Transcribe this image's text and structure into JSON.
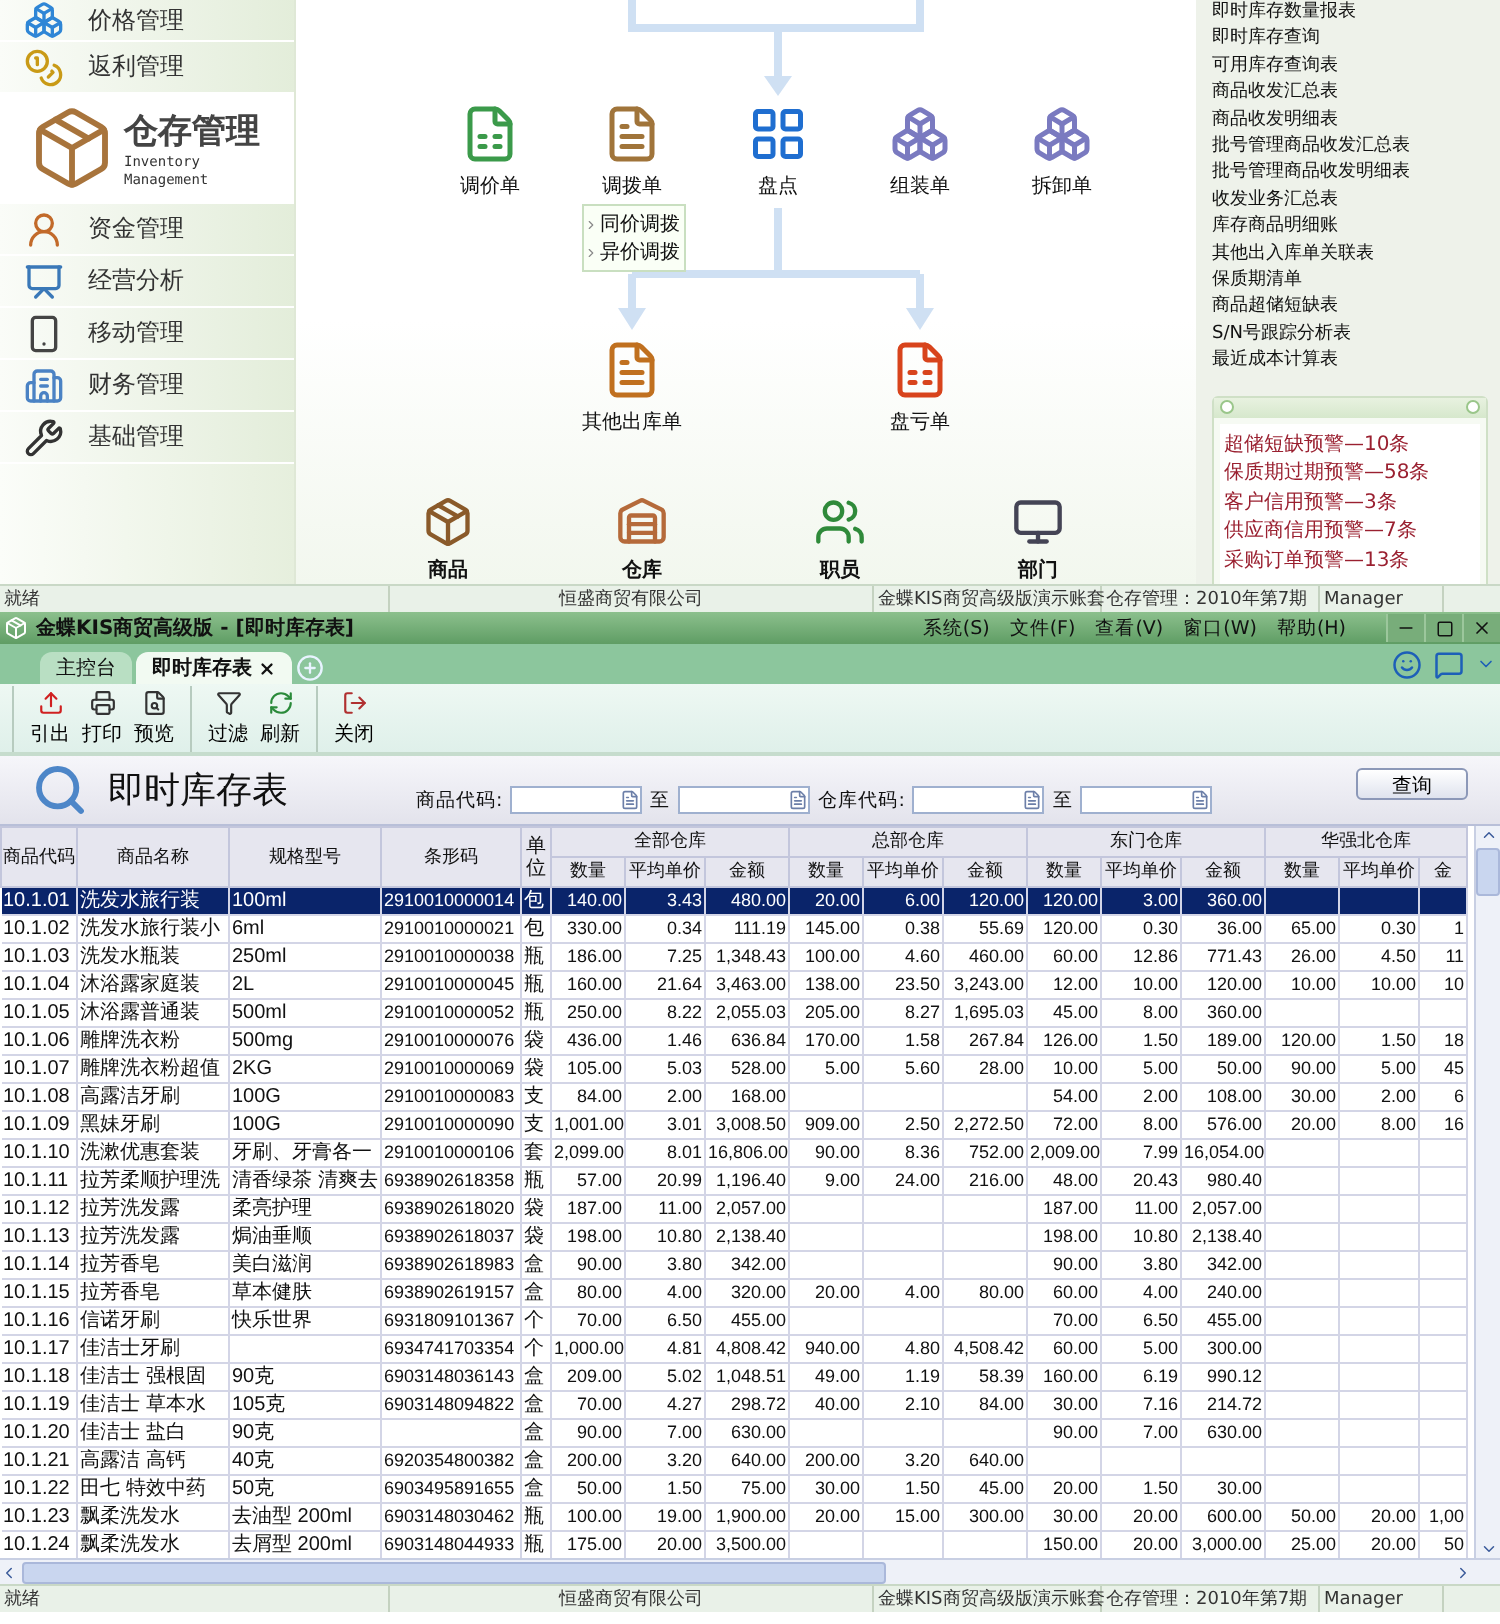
{
  "console": {
    "sidebar": {
      "items": [
        {
          "label": "价格管理",
          "selected": false
        },
        {
          "label": "返利管理",
          "selected": false
        },
        {
          "label": "仓存管理",
          "subtitle": "Inventory Management",
          "selected": true
        },
        {
          "label": "资金管理",
          "selected": false
        },
        {
          "label": "经营分析",
          "selected": false
        },
        {
          "label": "移动管理",
          "selected": false
        },
        {
          "label": "财务管理",
          "selected": false
        },
        {
          "label": "基础管理",
          "selected": false
        }
      ]
    },
    "flow": {
      "nodes": [
        "调价单",
        "调拨单",
        "盘点",
        "组装单",
        "拆卸单",
        "其他出库单",
        "盘亏单"
      ],
      "menu": [
        "同价调拨",
        "异价调拨"
      ],
      "shortcuts": [
        "商品",
        "仓库",
        "职员",
        "部门"
      ]
    },
    "reports": [
      "即时库存数量报表",
      "即时库存查询",
      "可用库存查询表",
      "商品收发汇总表",
      "商品收发明细表",
      "批号管理商品收发汇总表",
      "批号管理商品收发明细表",
      "收发业务汇总表",
      "库存商品明细账",
      "其他出入库单关联表",
      "保质期清单",
      "商品超储短缺表",
      "S/N号跟踪分析表",
      "最近成本计算表"
    ],
    "alerts": [
      "超储短缺预警—10条",
      "保质期过期预警—58条",
      "客户信用预警—3条",
      "供应商信用预警—7条",
      "采购订单预警—13条"
    ],
    "status_bar": [
      "就绪",
      "恒盛商贸有限公司",
      "金蝶KIS商贸高级版演示账套",
      "仓存管理：2010年第7期",
      "Manager"
    ]
  },
  "window": {
    "title": "金蝶KIS商贸高级版 - [即时库存表]",
    "menus": [
      "系统(S)",
      "文件(F)",
      "查看(V)",
      "窗口(W)",
      "帮助(H)"
    ],
    "tabs": [
      {
        "label": "主控台",
        "selected": false,
        "closable": false
      },
      {
        "label": "即时库存表",
        "selected": true,
        "closable": true
      }
    ],
    "toolbar": [
      [
        "引出",
        "打印",
        "预览"
      ],
      [
        "过滤",
        "刷新"
      ],
      [
        "关闭"
      ]
    ],
    "report": {
      "title": "即时库存表",
      "filters": [
        {
          "label": "商品代码:",
          "to": "至"
        },
        {
          "label": "仓库代码:",
          "to": "至"
        }
      ],
      "query_button": "查询"
    },
    "table": {
      "columns": [
        "商品代码",
        "商品名称",
        "规格型号",
        "条形码",
        "单位"
      ],
      "groups": [
        {
          "label": "全部仓库",
          "columns": [
            "数量",
            "平均单价",
            "金额"
          ]
        },
        {
          "label": "总部仓库",
          "columns": [
            "数量",
            "平均单价",
            "金额"
          ]
        },
        {
          "label": "东门仓库",
          "columns": [
            "数量",
            "平均单价",
            "金额"
          ]
        },
        {
          "label": "华强北仓库",
          "columns": [
            "数量",
            "平均单价",
            "金"
          ]
        }
      ],
      "rows": [
        {
          "code": "10.1.01",
          "name": "洗发水旅行装",
          "spec": "100ml",
          "barcode": "2910010000014",
          "unit": "包",
          "selected": true,
          "all": [
            "140.00",
            "3.43",
            "480.00"
          ],
          "hq": [
            "20.00",
            "6.00",
            "120.00"
          ],
          "east": [
            "120.00",
            "3.00",
            "360.00"
          ]
        },
        {
          "code": "10.1.02",
          "name": "洗发水旅行装小",
          "spec": "6ml",
          "barcode": "2910010000021",
          "unit": "包",
          "selected": false,
          "all": [
            "330.00",
            "0.34",
            "111.19"
          ],
          "hq": [
            "145.00",
            "0.38",
            "55.69"
          ],
          "east": [
            "120.00",
            "0.30",
            "36.00"
          ],
          "north": [
            "65.00",
            "0.30",
            "1"
          ]
        },
        {
          "code": "10.1.03",
          "name": "洗发水瓶装",
          "spec": "250ml",
          "barcode": "2910010000038",
          "unit": "瓶",
          "selected": false,
          "all": [
            "186.00",
            "7.25",
            "1,348.43"
          ],
          "hq": [
            "100.00",
            "4.60",
            "460.00"
          ],
          "east": [
            "60.00",
            "12.86",
            "771.43"
          ],
          "north": [
            "26.00",
            "4.50",
            "11"
          ]
        },
        {
          "code": "10.1.04",
          "name": "沐浴露家庭装",
          "spec": "2L",
          "barcode": "2910010000045",
          "unit": "瓶",
          "selected": false,
          "all": [
            "160.00",
            "21.64",
            "3,463.00"
          ],
          "hq": [
            "138.00",
            "23.50",
            "3,243.00"
          ],
          "east": [
            "12.00",
            "10.00",
            "120.00"
          ],
          "north": [
            "10.00",
            "10.00",
            "10"
          ]
        },
        {
          "code": "10.1.05",
          "name": "沐浴露普通装",
          "spec": "500ml",
          "barcode": "2910010000052",
          "unit": "瓶",
          "selected": false,
          "all": [
            "250.00",
            "8.22",
            "2,055.03"
          ],
          "hq": [
            "205.00",
            "8.27",
            "1,695.03"
          ],
          "east": [
            "45.00",
            "8.00",
            "360.00"
          ]
        },
        {
          "code": "10.1.06",
          "name": "雕牌洗衣粉",
          "spec": "500mg",
          "barcode": "2910010000076",
          "unit": "袋",
          "selected": false,
          "all": [
            "436.00",
            "1.46",
            "636.84"
          ],
          "hq": [
            "170.00",
            "1.58",
            "267.84"
          ],
          "east": [
            "126.00",
            "1.50",
            "189.00"
          ],
          "north": [
            "120.00",
            "1.50",
            "18"
          ]
        },
        {
          "code": "10.1.07",
          "name": "雕牌洗衣粉超值",
          "spec": "2KG",
          "barcode": "2910010000069",
          "unit": "袋",
          "selected": false,
          "all": [
            "105.00",
            "5.03",
            "528.00"
          ],
          "hq": [
            "5.00",
            "5.60",
            "28.00"
          ],
          "east": [
            "10.00",
            "5.00",
            "50.00"
          ],
          "north": [
            "90.00",
            "5.00",
            "45"
          ]
        },
        {
          "code": "10.1.08",
          "name": "高露洁牙刷",
          "spec": "100G",
          "barcode": "2910010000083",
          "unit": "支",
          "selected": false,
          "all": [
            "84.00",
            "2.00",
            "168.00"
          ],
          "east": [
            "54.00",
            "2.00",
            "108.00"
          ],
          "north": [
            "30.00",
            "2.00",
            "6"
          ]
        },
        {
          "code": "10.1.09",
          "name": "黑妹牙刷",
          "spec": "100G",
          "barcode": "2910010000090",
          "unit": "支",
          "selected": false,
          "all": [
            "1,001.00",
            "3.01",
            "3,008.50"
          ],
          "hq": [
            "909.00",
            "2.50",
            "2,272.50"
          ],
          "east": [
            "72.00",
            "8.00",
            "576.00"
          ],
          "north": [
            "20.00",
            "8.00",
            "16"
          ]
        },
        {
          "code": "10.1.10",
          "name": "洗漱优惠套装",
          "spec": "牙刷、牙膏各一",
          "barcode": "2910010000106",
          "unit": "套",
          "selected": false,
          "all": [
            "2,099.00",
            "8.01",
            "16,806.00"
          ],
          "hq": [
            "90.00",
            "8.36",
            "752.00"
          ],
          "east": [
            "2,009.00",
            "7.99",
            "16,054.00"
          ]
        },
        {
          "code": "10.1.11",
          "name": "拉芳柔顺护理洗",
          "spec": "清香绿茶 清爽去",
          "barcode": "6938902618358",
          "unit": "瓶",
          "selected": false,
          "all": [
            "57.00",
            "20.99",
            "1,196.40"
          ],
          "hq": [
            "9.00",
            "24.00",
            "216.00"
          ],
          "east": [
            "48.00",
            "20.43",
            "980.40"
          ]
        },
        {
          "code": "10.1.12",
          "name": "拉芳洗发露",
          "spec": "柔亮护理",
          "barcode": "6938902618020",
          "unit": "袋",
          "selected": false,
          "all": [
            "187.00",
            "11.00",
            "2,057.00"
          ],
          "east": [
            "187.00",
            "11.00",
            "2,057.00"
          ]
        },
        {
          "code": "10.1.13",
          "name": "拉芳洗发露",
          "spec": "焗油垂顺",
          "barcode": "6938902618037",
          "unit": "袋",
          "selected": false,
          "all": [
            "198.00",
            "10.80",
            "2,138.40"
          ],
          "east": [
            "198.00",
            "10.80",
            "2,138.40"
          ]
        },
        {
          "code": "10.1.14",
          "name": "拉芳香皂",
          "spec": "美白滋润",
          "barcode": "6938902618983",
          "unit": "盒",
          "selected": false,
          "all": [
            "90.00",
            "3.80",
            "342.00"
          ],
          "east": [
            "90.00",
            "3.80",
            "342.00"
          ]
        },
        {
          "code": "10.1.15",
          "name": "拉芳香皂",
          "spec": "草本健肤",
          "barcode": "6938902619157",
          "unit": "盒",
          "selected": false,
          "all": [
            "80.00",
            "4.00",
            "320.00"
          ],
          "hq": [
            "20.00",
            "4.00",
            "80.00"
          ],
          "east": [
            "60.00",
            "4.00",
            "240.00"
          ]
        },
        {
          "code": "10.1.16",
          "name": "信诺牙刷",
          "spec": "快乐世界",
          "barcode": "6931809101367",
          "unit": "个",
          "selected": false,
          "all": [
            "70.00",
            "6.50",
            "455.00"
          ],
          "east": [
            "70.00",
            "6.50",
            "455.00"
          ]
        },
        {
          "code": "10.1.17",
          "name": "佳洁士牙刷",
          "barcode": "6934741703354",
          "unit": "个",
          "selected": false,
          "all": [
            "1,000.00",
            "4.81",
            "4,808.42"
          ],
          "hq": [
            "940.00",
            "4.80",
            "4,508.42"
          ],
          "east": [
            "60.00",
            "5.00",
            "300.00"
          ]
        },
        {
          "code": "10.1.18",
          "name": "佳洁士 强根固",
          "spec": "90克",
          "barcode": "6903148036143",
          "unit": "盒",
          "selected": false,
          "all": [
            "209.00",
            "5.02",
            "1,048.51"
          ],
          "hq": [
            "49.00",
            "1.19",
            "58.39"
          ],
          "east": [
            "160.00",
            "6.19",
            "990.12"
          ]
        },
        {
          "code": "10.1.19",
          "name": "佳洁士 草本水",
          "spec": "105克",
          "barcode": "6903148094822",
          "unit": "盒",
          "selected": false,
          "all": [
            "70.00",
            "4.27",
            "298.72"
          ],
          "hq": [
            "40.00",
            "2.10",
            "84.00"
          ],
          "east": [
            "30.00",
            "7.16",
            "214.72"
          ]
        },
        {
          "code": "10.1.20",
          "name": "佳洁士 盐白",
          "spec": "90克",
          "unit": "盒",
          "selected": false,
          "all": [
            "90.00",
            "7.00",
            "630.00"
          ],
          "east": [
            "90.00",
            "7.00",
            "630.00"
          ]
        },
        {
          "code": "10.1.21",
          "name": "高露洁 高钙",
          "spec": "40克",
          "barcode": "6920354800382",
          "unit": "盒",
          "selected": false,
          "all": [
            "200.00",
            "3.20",
            "640.00"
          ],
          "hq": [
            "200.00",
            "3.20",
            "640.00"
          ]
        },
        {
          "code": "10.1.22",
          "name": "田七 特效中药",
          "spec": "50克",
          "barcode": "6903495891655",
          "unit": "盒",
          "selected": false,
          "all": [
            "50.00",
            "1.50",
            "75.00"
          ],
          "hq": [
            "30.00",
            "1.50",
            "45.00"
          ],
          "east": [
            "20.00",
            "1.50",
            "30.00"
          ]
        },
        {
          "code": "10.1.23",
          "name": "飘柔洗发水",
          "spec": "去油型 200ml",
          "barcode": "6903148030462",
          "unit": "瓶",
          "selected": false,
          "all": [
            "100.00",
            "19.00",
            "1,900.00"
          ],
          "hq": [
            "20.00",
            "15.00",
            "300.00"
          ],
          "east": [
            "30.00",
            "20.00",
            "600.00"
          ],
          "north": [
            "50.00",
            "20.00",
            "1,00"
          ]
        },
        {
          "code": "10.1.24",
          "name": "飘柔洗发水",
          "spec": "去屑型 200ml",
          "barcode": "6903148044933",
          "unit": "瓶",
          "selected": false,
          "all": [
            "175.00",
            "20.00",
            "3,500.00"
          ],
          "east": [
            "150.00",
            "20.00",
            "3,000.00"
          ],
          "north": [
            "25.00",
            "20.00",
            "50"
          ]
        }
      ]
    },
    "status_bar": [
      "就绪",
      "恒盛商贸有限公司",
      "金蝶KIS商贸高级版演示账套",
      "仓存管理：2010年第7期",
      "Manager"
    ]
  }
}
